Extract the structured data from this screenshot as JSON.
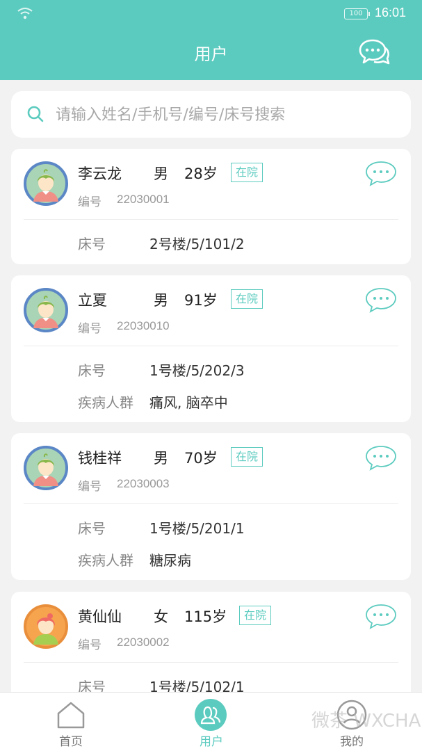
{
  "status_bar": {
    "battery": "100",
    "time": "16:01"
  },
  "header": {
    "title": "用户",
    "chat_icon": "chat-bubbles-icon"
  },
  "search": {
    "placeholder": "请输入姓名/手机号/编号/床号搜索",
    "icon": "search-icon"
  },
  "labels": {
    "code": "编号",
    "bed": "床号",
    "disease": "疾病人群"
  },
  "users": [
    {
      "name": "李云龙",
      "gender": "男",
      "age": "28岁",
      "status": "在院",
      "code": "22030001",
      "bed": "2号楼/5/101/2",
      "disease": ""
    },
    {
      "name": "立夏",
      "gender": "男",
      "age": "91岁",
      "status": "在院",
      "code": "22030010",
      "bed": "1号楼/5/202/3",
      "disease": "痛风, 脑卒中"
    },
    {
      "name": "钱桂祥",
      "gender": "男",
      "age": "70岁",
      "status": "在院",
      "code": "22030003",
      "bed": "1号楼/5/201/1",
      "disease": "糖尿病"
    },
    {
      "name": "黄仙仙",
      "gender": "女",
      "age": "115岁",
      "status": "在院",
      "code": "22030002",
      "bed": "1号楼/5/102/1",
      "disease": ""
    }
  ],
  "tabbar": {
    "home": "首页",
    "users": "用户",
    "mine": "我的"
  },
  "watermark": "微茶 WXCHA",
  "colors": {
    "primary": "#5ccbbf",
    "background": "#f2f2f2"
  }
}
